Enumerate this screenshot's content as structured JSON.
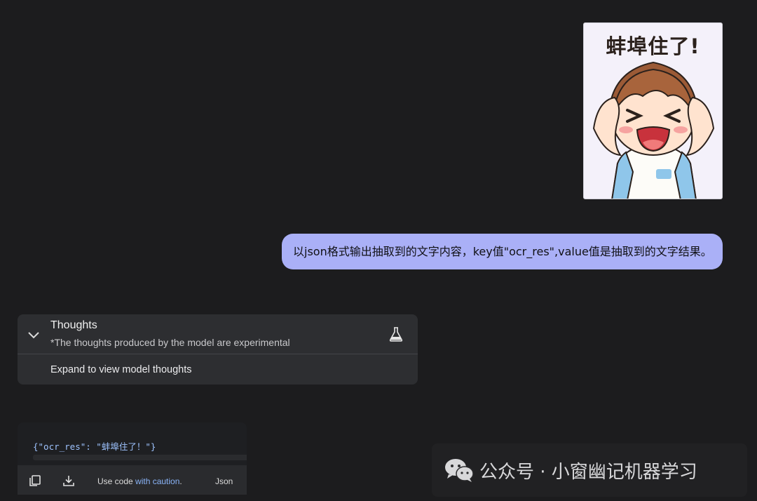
{
  "attachment": {
    "caption": "蚌埠住了!"
  },
  "user_message": {
    "text": "以json格式输出抽取到的文字内容，key值\"ocr_res\",value值是抽取到的文字结果。"
  },
  "thoughts": {
    "title": "Thoughts",
    "subtitle": "*The thoughts produced by the model are experimental",
    "expand_label": "Expand to view model thoughts"
  },
  "code_block": {
    "code": "{\"ocr_res\": \"蚌埠住了！\"}",
    "caution_prefix": "Use code ",
    "caution_link": "with caution",
    "caution_suffix": ".",
    "language": "Json"
  },
  "watermark": {
    "text": "公众号 · 小窗幽记机器学习"
  },
  "colors": {
    "background": "#1c1c1e",
    "user_bubble": "#aab0f7",
    "panel": "#2d2e31",
    "link": "#8ab4f8"
  }
}
